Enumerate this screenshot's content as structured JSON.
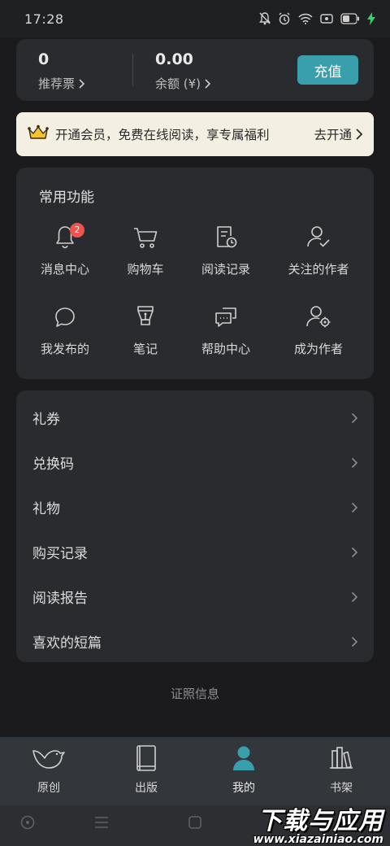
{
  "status_bar": {
    "time": "17:28",
    "battery": "41"
  },
  "wallet": {
    "tickets_value": "0",
    "tickets_label": "推荐票",
    "balance_value": "0.00",
    "balance_label": "余额 (¥)",
    "recharge_label": "充值"
  },
  "vip_banner": {
    "text": "开通会员，免费在线阅读，享专属福利",
    "link": "去开通"
  },
  "functions": {
    "title": "常用功能",
    "items": [
      {
        "label": "消息中心",
        "icon": "bell-icon",
        "badge": "2"
      },
      {
        "label": "购物车",
        "icon": "cart-icon"
      },
      {
        "label": "阅读记录",
        "icon": "reading-history-icon"
      },
      {
        "label": "关注的作者",
        "icon": "followed-author-icon"
      },
      {
        "label": "我发布的",
        "icon": "chat-bubble-icon"
      },
      {
        "label": "笔记",
        "icon": "pen-nib-icon"
      },
      {
        "label": "帮助中心",
        "icon": "help-chat-icon"
      },
      {
        "label": "成为作者",
        "icon": "author-settings-icon"
      }
    ]
  },
  "menu": {
    "items": [
      {
        "label": "礼券"
      },
      {
        "label": "兑换码"
      },
      {
        "label": "礼物"
      },
      {
        "label": "购买记录"
      },
      {
        "label": "阅读报告"
      },
      {
        "label": "喜欢的短篇"
      }
    ]
  },
  "license_link": "证照信息",
  "tabbar": {
    "active_color": "#3a9fad",
    "tabs": [
      {
        "label": "原创",
        "icon": "bird-icon"
      },
      {
        "label": "出版",
        "icon": "book-icon"
      },
      {
        "label": "我的",
        "icon": "user-icon"
      },
      {
        "label": "书架",
        "icon": "bookshelf-icon"
      }
    ]
  },
  "watermark": {
    "title": "下载与应用",
    "url": "www.xiazainiao.com"
  }
}
